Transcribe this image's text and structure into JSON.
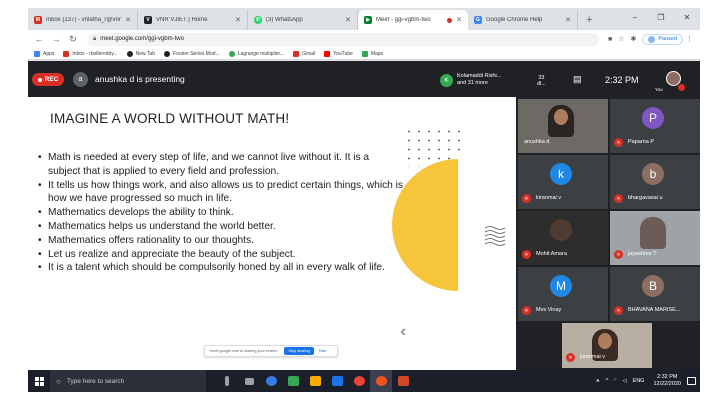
{
  "browser": {
    "tabs": [
      {
        "label": "Inbox (137) - vnlatha_r@vnrvjiet...",
        "icon": "gmail-icon",
        "color": "#d93025",
        "active": false
      },
      {
        "label": "VNR VJIET | Home",
        "icon": "vnr-icon",
        "color": "#202124",
        "active": false
      },
      {
        "label": "(3) WhatsApp",
        "icon": "whatsapp-icon",
        "color": "#25d366",
        "active": false
      },
      {
        "label": "Meet - ggi-vgbm-two",
        "icon": "meet-icon",
        "color": "#00832d",
        "active": true
      },
      {
        "label": "Google Chrome Help",
        "icon": "google-icon",
        "color": "#4285f4",
        "active": false
      }
    ],
    "new_tab": "+",
    "window_controls": {
      "minimize": "–",
      "maximize": "❐",
      "close": "✕"
    },
    "url": "meet.google.com/ggi-vgbm-two",
    "profile_status": "Paused",
    "bookmarks": [
      {
        "label": "Apps",
        "color": "#4285f4"
      },
      {
        "label": "Inbox - rbollereddy...",
        "color": "#d93025"
      },
      {
        "label": "New Tab",
        "color": "#202124"
      },
      {
        "label": "Fourier Series Mod...",
        "color": "#202124"
      },
      {
        "label": "Lagrange multiplier...",
        "color": "#34a853"
      },
      {
        "label": "Gmail",
        "color": "#d93025"
      },
      {
        "label": "YouTube",
        "color": "#ff0000"
      },
      {
        "label": "Maps",
        "color": "#34a853"
      }
    ]
  },
  "meet": {
    "rec_label": "REC",
    "presenter_initial": "a",
    "presenting_text": "anushka d is presenting",
    "participants_chip": {
      "initial": "K",
      "line1": "Kolamaddi Rishi...",
      "line2": "and 31 more"
    },
    "participant_count": {
      "line1": "33",
      "line2": "dl..."
    },
    "time": "2:32 PM",
    "you_label": "You"
  },
  "slide": {
    "title": "IMAGINE A WORLD WITHOUT MATH!",
    "bullets": [
      "Math is needed at every step of life, and we cannot live without it. It is a subject that is applied to every field and profession.",
      "It tells us how things work, and also allows us to predict certain things, which is how we have progressed so much in life.",
      "Mathematics develops the ability to think.",
      "Mathematics helps us understand the world better.",
      "Mathematics offers rationality to our thoughts.",
      "Let us realize and appreciate the beauty of the subject.",
      "It is a talent which should be compulsorily honed by all in every walk of life."
    ],
    "share_notice": "meet.google.com is sharing your screen.",
    "stop_sharing": "Stop sharing",
    "hide": "Hide",
    "accent_color": "#f7c53a"
  },
  "participants": [
    {
      "name": "anushka d",
      "initial": "",
      "color": "",
      "video": true,
      "muted": false
    },
    {
      "name": "Paparna P",
      "initial": "P",
      "color": "#7e57c2",
      "video": false,
      "muted": true
    },
    {
      "name": "kiranmai v",
      "initial": "k",
      "color": "#1e88e5",
      "video": false,
      "muted": true
    },
    {
      "name": "bhargavasai u",
      "initial": "b",
      "color": "#8d6e63",
      "video": false,
      "muted": true
    },
    {
      "name": "Mohit Amara",
      "initial": "",
      "color": "",
      "video": true,
      "muted": true
    },
    {
      "name": "jayashree T",
      "initial": "",
      "color": "",
      "video": true,
      "muted": true
    },
    {
      "name": "Mvs Vinay",
      "initial": "M",
      "color": "#1e88e5",
      "video": false,
      "muted": true
    },
    {
      "name": "BHAVANA MARISE...",
      "initial": "B",
      "color": "#8d6e63",
      "video": false,
      "muted": true
    },
    {
      "name": "kiranmai v",
      "initial": "",
      "color": "",
      "video": true,
      "muted": true
    }
  ],
  "taskbar": {
    "search_placeholder": "Type here to search",
    "time": "2:32 PM",
    "date": "12/22/2020",
    "language": "ENG",
    "app_colors": [
      "#9aa0a6",
      "#9aa0a6",
      "#3b78e7",
      "#34a853",
      "#f9ab00",
      "#1a73e8",
      "#ea4335",
      "#f4511e",
      "#d24726"
    ]
  }
}
